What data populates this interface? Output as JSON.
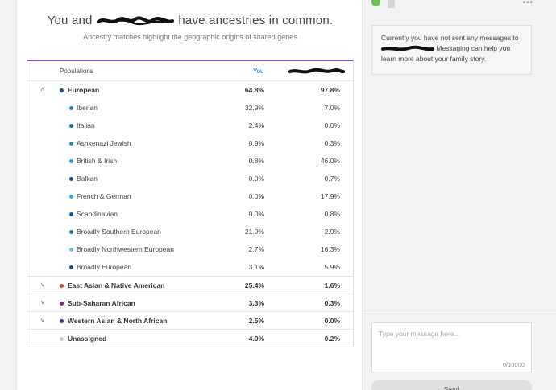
{
  "header": {
    "title_prefix": "You and",
    "title_suffix": "have ancestries in common.",
    "subtitle": "Ancestry matches highlight the geographic origins of shared genes"
  },
  "table": {
    "col_populations": "Populations",
    "col_you": "You",
    "rows": [
      {
        "kind": "group",
        "expanded": true,
        "label": "European",
        "you": "64.8%",
        "them": "97.8%",
        "color": "#1f4e8c"
      },
      {
        "kind": "sub",
        "label": "Iberian",
        "you": "32.9%",
        "them": "7.0%",
        "color": "#3a7fc2"
      },
      {
        "kind": "sub",
        "label": "Italian",
        "you": "2.4%",
        "them": "0.0%",
        "color": "#1e5fa8"
      },
      {
        "kind": "sub",
        "label": "Ashkenazi Jewish",
        "you": "0.9%",
        "them": "0.3%",
        "color": "#2d8fa8"
      },
      {
        "kind": "sub",
        "label": "British & Irish",
        "you": "0.8%",
        "them": "46.0%",
        "color": "#3c9ad6"
      },
      {
        "kind": "sub",
        "label": "Balkan",
        "you": "0.0%",
        "them": "0.7%",
        "color": "#1c4f80"
      },
      {
        "kind": "sub",
        "label": "French & German",
        "you": "0.0%",
        "them": "17.9%",
        "color": "#36b0d8"
      },
      {
        "kind": "sub",
        "label": "Scandinavian",
        "you": "0.0%",
        "them": "0.8%",
        "color": "#1d5d9a"
      },
      {
        "kind": "sub",
        "label": "Broadly Southern European",
        "you": "21.9%",
        "them": "2.9%",
        "color": "#2d74b5"
      },
      {
        "kind": "sub",
        "label": "Broadly Northwestern European",
        "you": "2.7%",
        "them": "16.3%",
        "color": "#6fc3e4"
      },
      {
        "kind": "sub",
        "label": "Broadly European",
        "you": "3.1%",
        "them": "5.9%",
        "color": "#1f4e8c"
      },
      {
        "kind": "group",
        "expanded": false,
        "label": "East Asian & Native American",
        "you": "25.4%",
        "them": "1.6%",
        "color": "#d4452f"
      },
      {
        "kind": "group",
        "expanded": false,
        "label": "Sub-Saharan African",
        "you": "3.3%",
        "them": "0.3%",
        "color": "#8b1c7a"
      },
      {
        "kind": "group",
        "expanded": false,
        "label": "Western Asian & North African",
        "you": "2.5%",
        "them": "0.0%",
        "color": "#4a2a8a"
      },
      {
        "kind": "group",
        "expanded": null,
        "label": "Unassigned",
        "you": "4.0%",
        "them": "0.2%",
        "color": "#c8c8c8"
      }
    ]
  },
  "sidebar": {
    "info_prefix": "Currently you have not sent any messages to",
    "info_suffix": "Messaging can help you learn more about your family story.",
    "message_placeholder": "Type your message here...",
    "counter": "0/10000",
    "send_label": "Send"
  },
  "colors": {
    "accent_purple": "#8a4fb3",
    "you_blue": "#2c7cc0",
    "chat_green": "#6cc35a"
  },
  "icons": {
    "chat": "chat-bubble-icon",
    "document": "document-icon",
    "more": "more-dots-icon",
    "expand": "chevron-icon"
  }
}
